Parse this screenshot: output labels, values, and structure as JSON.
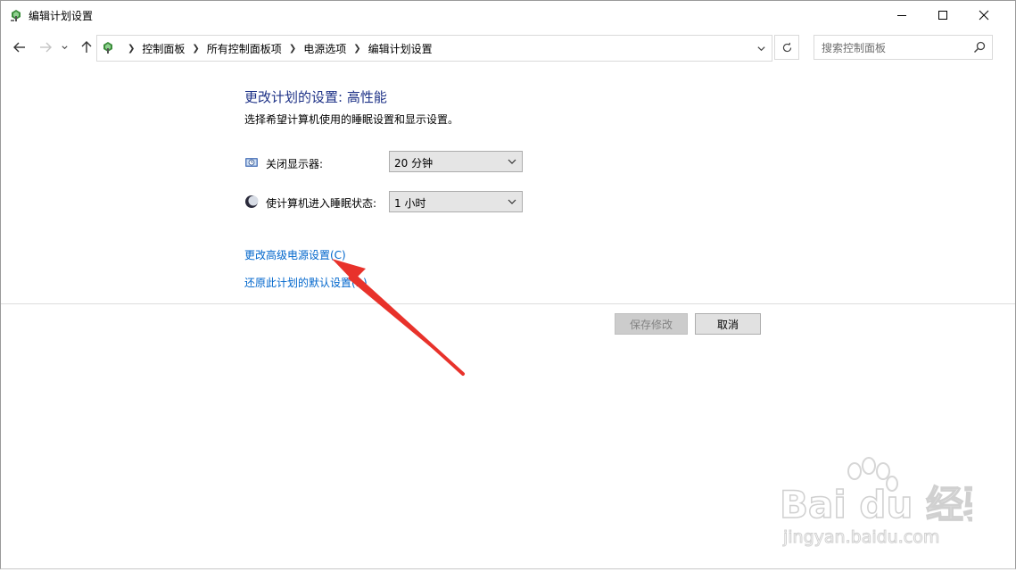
{
  "window": {
    "title": "编辑计划设置"
  },
  "address_bar": {
    "breadcrumbs": [
      {
        "label": "控制面板"
      },
      {
        "label": "所有控制面板项"
      },
      {
        "label": "电源选项"
      },
      {
        "label": "编辑计划设置"
      }
    ]
  },
  "search": {
    "placeholder": "搜索控制面板"
  },
  "page": {
    "heading": "更改计划的设置: 高性能",
    "subtext": "选择希望计算机使用的睡眠设置和显示设置。",
    "display_off": {
      "label": "关闭显示器:",
      "value": "20 分钟"
    },
    "sleep": {
      "label": "使计算机进入睡眠状态:",
      "value": "1 小时"
    },
    "links": {
      "advanced": "更改高级电源设置(C)",
      "restore": "还原此计划的默认设置(R)"
    },
    "buttons": {
      "save": "保存修改",
      "cancel": "取消"
    }
  },
  "watermark": {
    "logo": "Bai du 经验",
    "site": "jingyan.baidu.com"
  },
  "colors": {
    "heading": "#1e3287",
    "link": "#0066cc",
    "annotation_arrow": "#e8322b"
  },
  "icons": {
    "app": "power-options-icon",
    "back": "arrow-left-icon",
    "forward": "arrow-right-icon",
    "recent": "chevron-down-icon",
    "up": "arrow-up-icon",
    "refresh": "refresh-icon",
    "search": "search-icon",
    "display": "monitor-clock-icon",
    "sleep": "moon-icon"
  }
}
